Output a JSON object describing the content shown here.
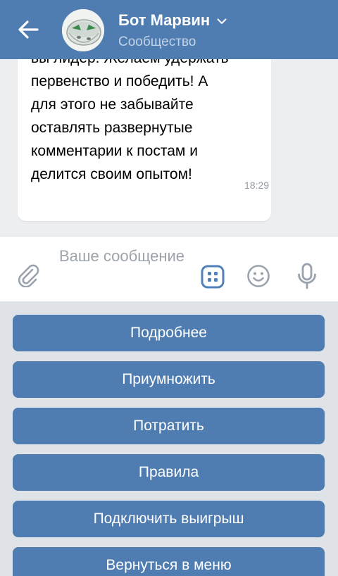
{
  "header": {
    "title": "Бот Марвин",
    "subtitle": "Сообщество",
    "back_icon": "arrow-left-icon",
    "title_chevron_icon": "chevron-down-icon",
    "avatar_icon": "bot-avatar",
    "background_color": "#4f7db1"
  },
  "chat": {
    "message": {
      "lines": [
        "вы лидер. Желаем удержать",
        "первенство и победить! А",
        "для этого не забывайте",
        "оставлять развернутые",
        "комментарии к постам и",
        "делится своим опытом!"
      ],
      "time": "18:29"
    }
  },
  "composer": {
    "placeholder": "Ваше сообщение",
    "attach_icon": "paperclip-icon",
    "keyboard_icon": "bot-keyboard-icon",
    "emoji_icon": "smile-icon",
    "mic_icon": "microphone-icon"
  },
  "keyboard": {
    "buttons": [
      "Подробнее",
      "Приумножить",
      "Потратить",
      "Правила",
      "Подключить выигрыш",
      "Вернуться в меню"
    ],
    "button_color": "#4f7db1"
  }
}
